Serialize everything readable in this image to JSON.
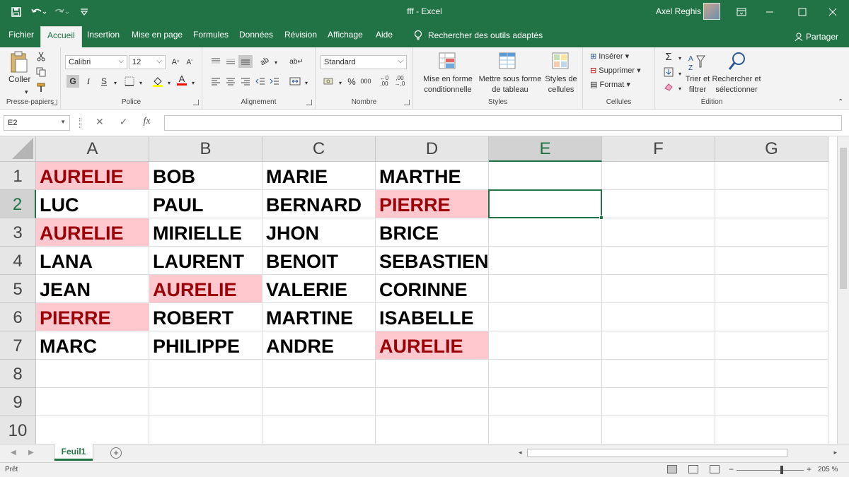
{
  "window": {
    "title": "fff  -  Excel",
    "user": "Axel Reghis"
  },
  "colors": {
    "brand": "#217346",
    "duplicate_fill": "#ffc7ce",
    "duplicate_text": "#9c0006"
  },
  "ribbon_tabs": [
    "Fichier",
    "Accueil",
    "Insertion",
    "Mise en page",
    "Formules",
    "Données",
    "Révision",
    "Affichage",
    "Aide"
  ],
  "active_tab": "Accueil",
  "tell_me": "Rechercher des outils adaptés",
  "share": "Partager",
  "ribbon": {
    "clipboard": {
      "paste": "Coller",
      "label": "Presse-papiers"
    },
    "font": {
      "name": "Calibri",
      "size": "12",
      "bold": "G",
      "italic": "I",
      "underline": "S",
      "label": "Police"
    },
    "alignment": {
      "label": "Alignement"
    },
    "number": {
      "format": "Standard",
      "percent": "%",
      "thousands": "000",
      "label": "Nombre"
    },
    "styles": {
      "conditional": "Mise en forme conditionnelle",
      "table": "Mettre sous forme de tableau",
      "cell_styles": "Styles de cellules",
      "label": "Styles"
    },
    "cells": {
      "insert": "Insérer",
      "delete": "Supprimer",
      "format": "Format",
      "label": "Cellules"
    },
    "editing": {
      "sort": "Trier et filtrer",
      "find": "Rechercher et sélectionner",
      "label": "Édition"
    }
  },
  "formula_bar": {
    "name_box": "E2",
    "formula": ""
  },
  "sheet": {
    "columns": [
      "A",
      "B",
      "C",
      "D",
      "E",
      "F",
      "G"
    ],
    "rows": [
      "1",
      "2",
      "3",
      "4",
      "5",
      "6",
      "7",
      "8",
      "9",
      "10"
    ],
    "active_cell": "E2",
    "cells": [
      [
        "AURELIE",
        "BOB",
        "MARIE",
        "MARTHE"
      ],
      [
        "LUC",
        "PAUL",
        "BERNARD",
        "PIERRE"
      ],
      [
        "AURELIE",
        "MIRIELLE",
        "JHON",
        "BRICE"
      ],
      [
        "LANA",
        "LAURENT",
        "BENOIT",
        "SEBASTIEN"
      ],
      [
        "JEAN",
        "AURELIE",
        "VALERIE",
        "CORINNE"
      ],
      [
        "PIERRE",
        "ROBERT",
        "MARTINE",
        "ISABELLE"
      ],
      [
        "MARC",
        "PHILIPPE",
        "ANDRE",
        "AURELIE"
      ]
    ],
    "highlighted_cells": [
      "A1",
      "D2",
      "A3",
      "B5",
      "A6",
      "D7"
    ]
  },
  "sheet_tabs": [
    "Feuil1"
  ],
  "status": {
    "ready": "Prêt",
    "zoom": "205 %"
  },
  "icons": {
    "save": "save-icon",
    "undo": "undo-icon",
    "redo": "redo-icon",
    "customize": "customize-qat-icon",
    "lightbulb": "lightbulb-icon",
    "share": "person-icon",
    "cut": "scissors-icon",
    "copy": "copy-icon",
    "format_painter": "brush-icon",
    "autosum": "sigma-icon",
    "sort": "sort-icon",
    "find": "magnifier-icon"
  }
}
